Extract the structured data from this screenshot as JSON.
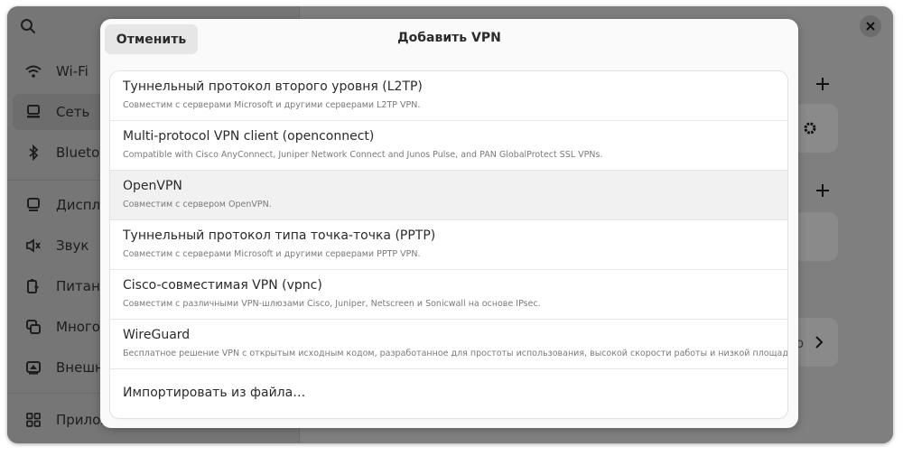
{
  "sidebar": {
    "items": [
      {
        "label": "Wi-Fi",
        "icon": "wifi-icon"
      },
      {
        "label": "Сеть",
        "icon": "network-icon"
      },
      {
        "label": "Bluetooth",
        "icon": "bluetooth-icon"
      },
      {
        "label": "Дисплеи",
        "icon": "display-icon"
      },
      {
        "label": "Звук",
        "icon": "sound-icon"
      },
      {
        "label": "Питание",
        "icon": "power-icon"
      },
      {
        "label": "Многозадачность",
        "icon": "multitasking-icon"
      },
      {
        "label": "Внешний вид",
        "icon": "appearance-icon"
      },
      {
        "label": "Приложения",
        "icon": "apps-icon"
      }
    ]
  },
  "background": {
    "partial_text": "о"
  },
  "dialog": {
    "cancel_label": "Отменить",
    "title": "Добавить VPN",
    "options": [
      {
        "title": "Туннельный протокол второго уровня (L2TP)",
        "subtitle": "Совместим с серверами Microsoft и другими серверами L2TP VPN."
      },
      {
        "title": "Multi-protocol VPN client (openconnect)",
        "subtitle": "Compatible with Cisco AnyConnect, Juniper Network Connect and Junos Pulse, and PAN GlobalProtect SSL VPNs."
      },
      {
        "title": "OpenVPN",
        "subtitle": "Совместим с сервером OpenVPN."
      },
      {
        "title": "Туннельный протокол типа точка-точка (PPTP)",
        "subtitle": "Совместим с серверами Microsoft и другими серверами PPTP VPN."
      },
      {
        "title": "Cisco-совместимая VPN (vpnc)",
        "subtitle": "Совместим с различными VPN-шлюзами Cisco, Juniper, Netscreen и Sonicwall на основе IPsec."
      },
      {
        "title": "WireGuard",
        "subtitle": "Бесплатное решение VPN с открытым исходным кодом, разработанное для простоты использования, высокой скорости работы и низкой площади атаки."
      }
    ],
    "import_label": "Импортировать из файла…"
  }
}
